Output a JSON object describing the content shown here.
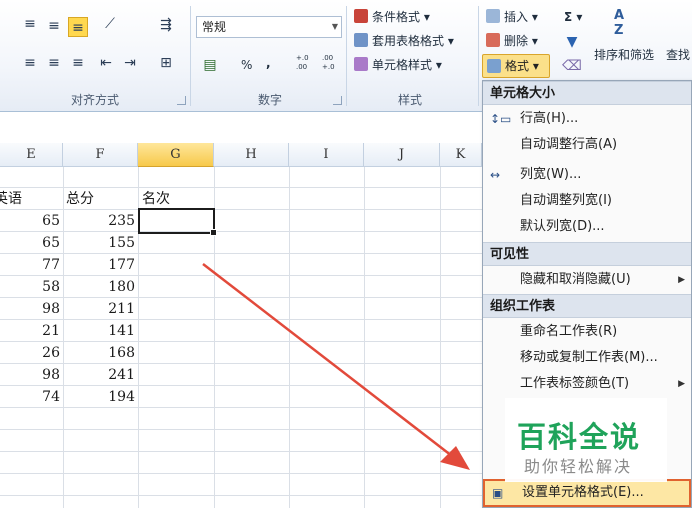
{
  "ribbon": {
    "number_format_value": "常规",
    "percent_label": "%",
    "comma_label": ",",
    "inc_decimal_label": "+.0 .00",
    "dec_decimal_label": ".00 +.0",
    "sum_label": "Σ",
    "groups": {
      "alignment": "对齐方式",
      "number": "数字",
      "styles": "样式"
    },
    "styles_buttons": {
      "conditional": "条件格式",
      "table": "套用表格格式",
      "cell_styles": "单元格样式"
    },
    "cells_buttons": {
      "insert": "插入",
      "delete": "删除",
      "format": "格式"
    },
    "sort_filter": "排序和筛选",
    "find_partial": "查找",
    "sort_icon_text": "A\nZ"
  },
  "grid": {
    "columns": [
      "E",
      "F",
      "G",
      "H",
      "I",
      "J",
      "K"
    ],
    "selected_column": "G",
    "headers_row": {
      "E": "英语",
      "F": "总分",
      "G": "名次"
    },
    "rows": [
      {
        "E": "65",
        "F": "235"
      },
      {
        "E": "65",
        "F": "155"
      },
      {
        "E": "77",
        "F": "177"
      },
      {
        "E": "58",
        "F": "180"
      },
      {
        "E": "98",
        "F": "211"
      },
      {
        "E": "21",
        "F": "141"
      },
      {
        "E": "26",
        "F": "168"
      },
      {
        "E": "98",
        "F": "241"
      },
      {
        "E": "74",
        "F": "194"
      }
    ]
  },
  "menu": {
    "sections": [
      {
        "title": "单元格大小",
        "items": [
          {
            "label": "行高(H)...",
            "icon": "row-height-icon"
          },
          {
            "label": "自动调整行高(A)",
            "icon": ""
          },
          {
            "label": "列宽(W)...",
            "icon": "column-width-icon"
          },
          {
            "label": "自动调整列宽(I)",
            "icon": ""
          },
          {
            "label": "默认列宽(D)...",
            "icon": ""
          }
        ]
      },
      {
        "title": "可见性",
        "items": [
          {
            "label": "隐藏和取消隐藏(U)",
            "icon": "",
            "submenu": true
          }
        ]
      },
      {
        "title": "组织工作表",
        "items": [
          {
            "label": "重命名工作表(R)",
            "icon": ""
          },
          {
            "label": "移动或复制工作表(M)...",
            "icon": ""
          },
          {
            "label": "工作表标签颜色(T)",
            "icon": "",
            "submenu": true
          }
        ]
      }
    ],
    "format_cells": "设置单元格格式(E)..."
  },
  "watermark": {
    "title": "百科全说",
    "subtitle": "助你轻松解决"
  },
  "colors": {
    "accent_selected": "#ffd84f",
    "highlight_border": "#e0622f",
    "arrow": "#e24a3b",
    "watermark_green": "#1fa35a"
  }
}
